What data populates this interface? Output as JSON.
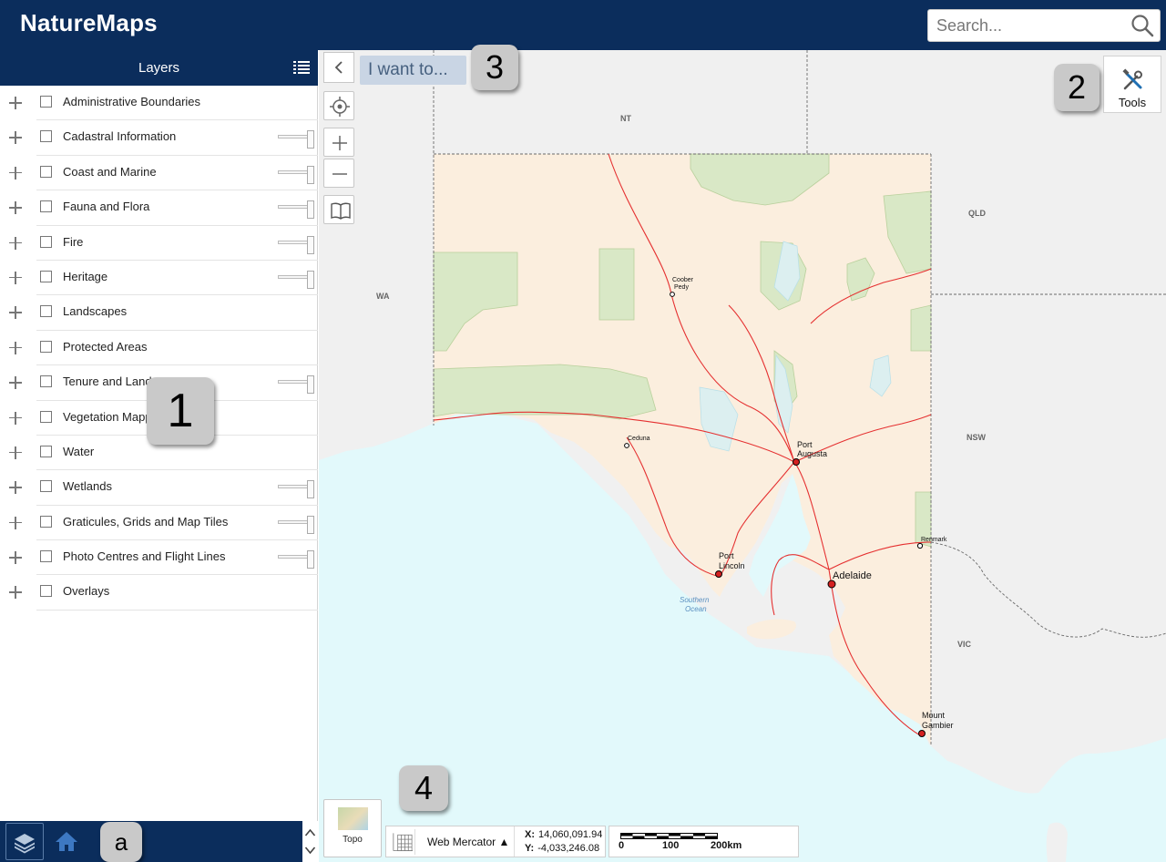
{
  "app": {
    "title": "NatureMaps"
  },
  "search": {
    "placeholder": "Search..."
  },
  "layers_panel": {
    "title": "Layers",
    "items": [
      {
        "label": "Administrative Boundaries",
        "slider": false
      },
      {
        "label": "Cadastral Information",
        "slider": true
      },
      {
        "label": "Coast and Marine",
        "slider": true
      },
      {
        "label": "Fauna and Flora",
        "slider": true
      },
      {
        "label": "Fire",
        "slider": true
      },
      {
        "label": "Heritage",
        "slider": true
      },
      {
        "label": "Landscapes",
        "slider": false
      },
      {
        "label": "Protected Areas",
        "slider": false
      },
      {
        "label": "Tenure and Landuse",
        "slider": true
      },
      {
        "label": "Vegetation Mapping",
        "slider": false
      },
      {
        "label": "Water",
        "slider": false
      },
      {
        "label": "Wetlands",
        "slider": true
      },
      {
        "label": "Graticules, Grids and Map Tiles",
        "slider": true
      },
      {
        "label": "Photo Centres and Flight Lines",
        "slider": true
      },
      {
        "label": "Overlays",
        "slider": false
      }
    ]
  },
  "toolbar": {
    "i_want_to": "I want to...",
    "tools_label": "Tools"
  },
  "basemap": {
    "label": "Topo"
  },
  "coordinates": {
    "projection": "Web Mercator ▲",
    "x_label": "X:",
    "x_value": "14,060,091.94",
    "y_label": "Y:",
    "y_value": "-4,033,246.08"
  },
  "scalebar": {
    "labels": [
      "0",
      "100",
      "200km"
    ]
  },
  "callouts": {
    "one": "1",
    "two": "2",
    "three": "3",
    "four": "4",
    "a": "a"
  },
  "map_labels": {
    "states": {
      "nt": "NT",
      "qld": "QLD",
      "wa": "WA",
      "nsw": "NSW",
      "vic": "VIC"
    },
    "cities": {
      "coober_pedy_1": "Coober",
      "coober_pedy_2": "Pedy",
      "ceduna": "Ceduna",
      "port_augusta_1": "Port",
      "port_augusta_2": "Augusta",
      "renmark": "Renmark",
      "port_lincoln_1": "Port",
      "port_lincoln_2": "Lincoln",
      "adelaide": "Adelaide",
      "mount_gambier_1": "Mount",
      "mount_gambier_2": "Gambier"
    },
    "ocean_1": "Southern",
    "ocean_2": "Ocean"
  },
  "colors": {
    "brand": "#0b2d5c",
    "ocean": "#e2f9fb",
    "land_sa": "#fbeede",
    "land_other": "#f0f0f0",
    "parks": "#d9e8c6",
    "roads": "#e53030"
  }
}
